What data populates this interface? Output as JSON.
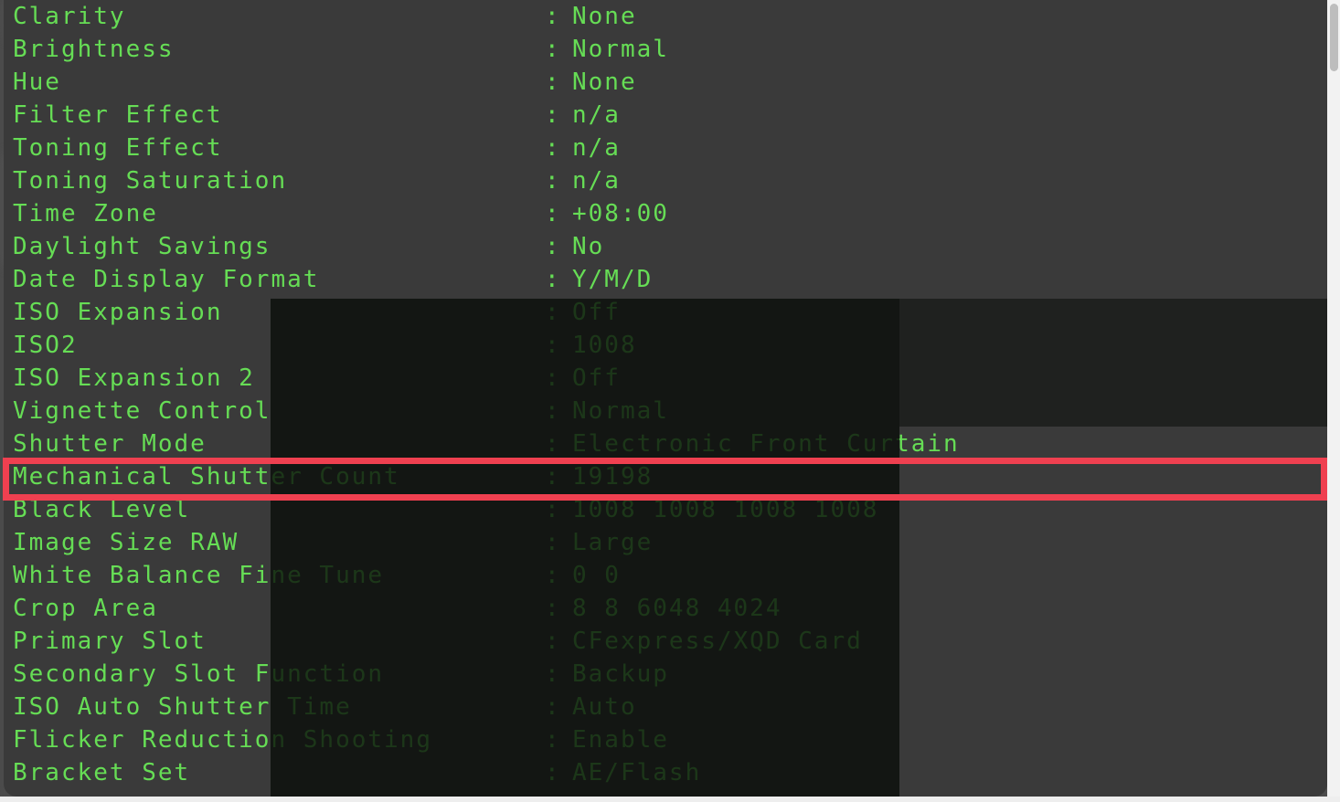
{
  "app": {
    "kind": "exif-metadata-viewer",
    "accent_red": "#ef4050",
    "text_green": "#66dd55",
    "panel_bg": "#3a3a3a"
  },
  "metadata": {
    "separator": ":",
    "rows": [
      {
        "label": "Clarity",
        "value": "None"
      },
      {
        "label": "Brightness",
        "value": "Normal"
      },
      {
        "label": "Hue",
        "value": "None"
      },
      {
        "label": "Filter Effect",
        "value": "n/a"
      },
      {
        "label": "Toning Effect",
        "value": "n/a"
      },
      {
        "label": "Toning Saturation",
        "value": "n/a"
      },
      {
        "label": "Time Zone",
        "value": "+08:00"
      },
      {
        "label": "Daylight Savings",
        "value": "No"
      },
      {
        "label": "Date Display Format",
        "value": "Y/M/D"
      },
      {
        "label": "ISO Expansion",
        "value": "Off"
      },
      {
        "label": "ISO2",
        "value": "1008"
      },
      {
        "label": "ISO Expansion 2",
        "value": "Off"
      },
      {
        "label": "Vignette Control",
        "value": "Normal"
      },
      {
        "label": "Shutter Mode",
        "value": "Electronic Front Curtain"
      },
      {
        "label": "Mechanical Shutter Count",
        "value": "19198",
        "highlighted": true
      },
      {
        "label": "Black Level",
        "value": "1008 1008 1008 1008"
      },
      {
        "label": "Image Size RAW",
        "value": "Large"
      },
      {
        "label": "White Balance Fine Tune",
        "value": "0 0"
      },
      {
        "label": "Crop Area",
        "value": "8 8 6048 4024"
      },
      {
        "label": "Primary Slot",
        "value": "CFexpress/XQD Card"
      },
      {
        "label": "Secondary Slot Function",
        "value": "Backup"
      },
      {
        "label": "ISO Auto Shutter Time",
        "value": "Auto"
      },
      {
        "label": "Flicker Reduction Shooting",
        "value": "Enable"
      },
      {
        "label": "Bracket Set",
        "value": "AE/Flash"
      }
    ]
  },
  "highlight": {
    "target_label": "Mechanical Shutter Count",
    "target_value": "19198",
    "color": "#ef4050"
  }
}
